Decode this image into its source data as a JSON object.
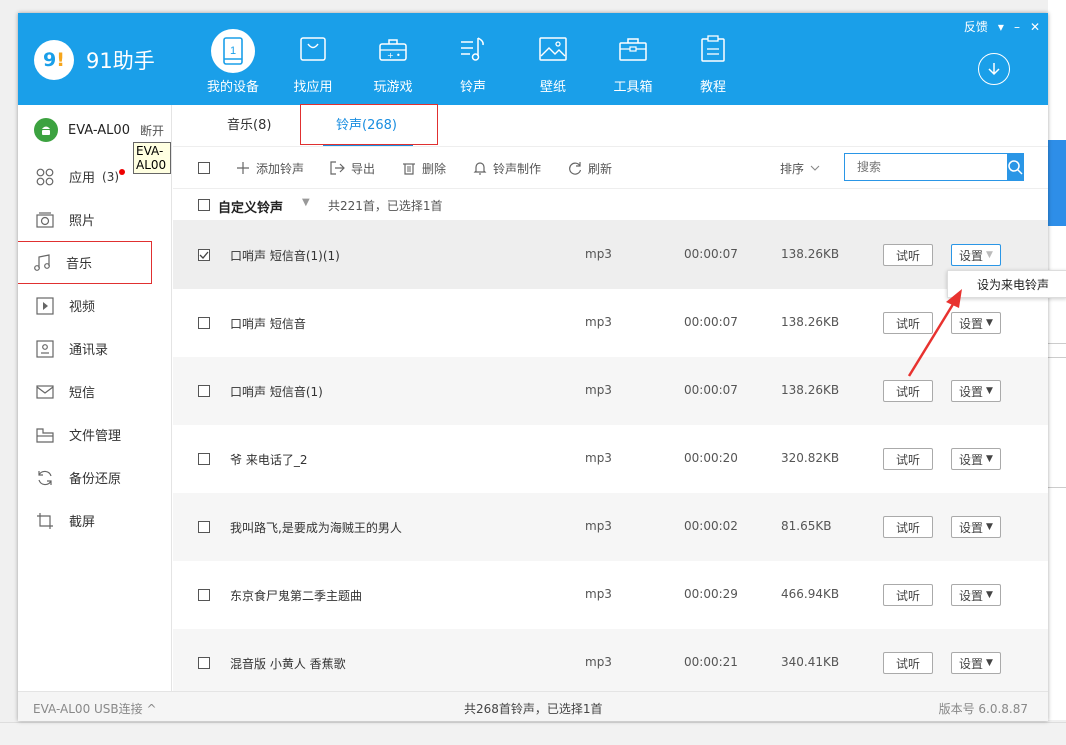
{
  "app": {
    "logo_mark": "9",
    "name": "91助手"
  },
  "window_controls": {
    "feedback": "反馈",
    "menu": "▾",
    "minimize": "–",
    "close": "✕"
  },
  "nav": [
    {
      "label": "我的设备",
      "icon": "phone-icon",
      "active": true
    },
    {
      "label": "找应用",
      "icon": "bag-icon"
    },
    {
      "label": "玩游戏",
      "icon": "gamepad-icon"
    },
    {
      "label": "铃声",
      "icon": "music-note-icon"
    },
    {
      "label": "壁纸",
      "icon": "image-icon"
    },
    {
      "label": "工具箱",
      "icon": "toolbox-icon"
    },
    {
      "label": "教程",
      "icon": "clipboard-icon"
    }
  ],
  "device": {
    "name": "EVA-AL00",
    "disconnect": "断开",
    "tooltip": "EVA-AL00"
  },
  "sidebar": [
    {
      "label": "应用",
      "count": "(3)",
      "icon": "apps-icon",
      "badge": true
    },
    {
      "label": "照片",
      "icon": "camera-icon"
    },
    {
      "label": "音乐",
      "icon": "music-icon",
      "active": true
    },
    {
      "label": "视频",
      "icon": "video-icon"
    },
    {
      "label": "通讯录",
      "icon": "contacts-icon"
    },
    {
      "label": "短信",
      "icon": "mail-icon"
    },
    {
      "label": "文件管理",
      "icon": "folder-icon"
    },
    {
      "label": "备份还原",
      "icon": "sync-icon"
    },
    {
      "label": "截屏",
      "icon": "crop-icon"
    }
  ],
  "tabs": {
    "music": "音乐(8)",
    "ringtone": "铃声(268)"
  },
  "toolbar": {
    "add": "添加铃声",
    "export": "导出",
    "delete": "删除",
    "make": "铃声制作",
    "refresh": "刷新",
    "sort": "排序",
    "search_placeholder": "搜索"
  },
  "category": {
    "name": "自定义铃声",
    "count": "共221首，已选择1首"
  },
  "rows": [
    {
      "name": "口哨声 短信音(1)(1)",
      "format": "mp3",
      "duration": "00:00:07",
      "size": "138.26KB",
      "checked": true
    },
    {
      "name": "口哨声 短信音",
      "format": "mp3",
      "duration": "00:00:07",
      "size": "138.26KB",
      "checked": false
    },
    {
      "name": "口哨声 短信音(1)",
      "format": "mp3",
      "duration": "00:00:07",
      "size": "138.26KB",
      "checked": false
    },
    {
      "name": "爷 来电话了_2",
      "format": "mp3",
      "duration": "00:00:20",
      "size": "320.82KB",
      "checked": false
    },
    {
      "name": "我叫路飞,是要成为海贼王的男人",
      "format": "mp3",
      "duration": "00:00:02",
      "size": "81.65KB",
      "checked": false
    },
    {
      "name": "东京食尸鬼第二季主题曲",
      "format": "mp3",
      "duration": "00:00:29",
      "size": "466.94KB",
      "checked": false
    },
    {
      "name": "混音版 小黄人 香蕉歌",
      "format": "mp3",
      "duration": "00:00:21",
      "size": "340.41KB",
      "checked": false
    }
  ],
  "row_buttons": {
    "listen": "试听",
    "settings": "设置"
  },
  "dropdown": {
    "set_ringtone": "设为来电铃声"
  },
  "status": {
    "connection": "EVA-AL00  USB连接 ^",
    "summary": "共268首铃声，已选择1首",
    "version": "版本号 6.0.8.87"
  },
  "colors": {
    "brand": "#1a9fe9",
    "highlight": "#e03030",
    "link": "#1a8ee0"
  }
}
